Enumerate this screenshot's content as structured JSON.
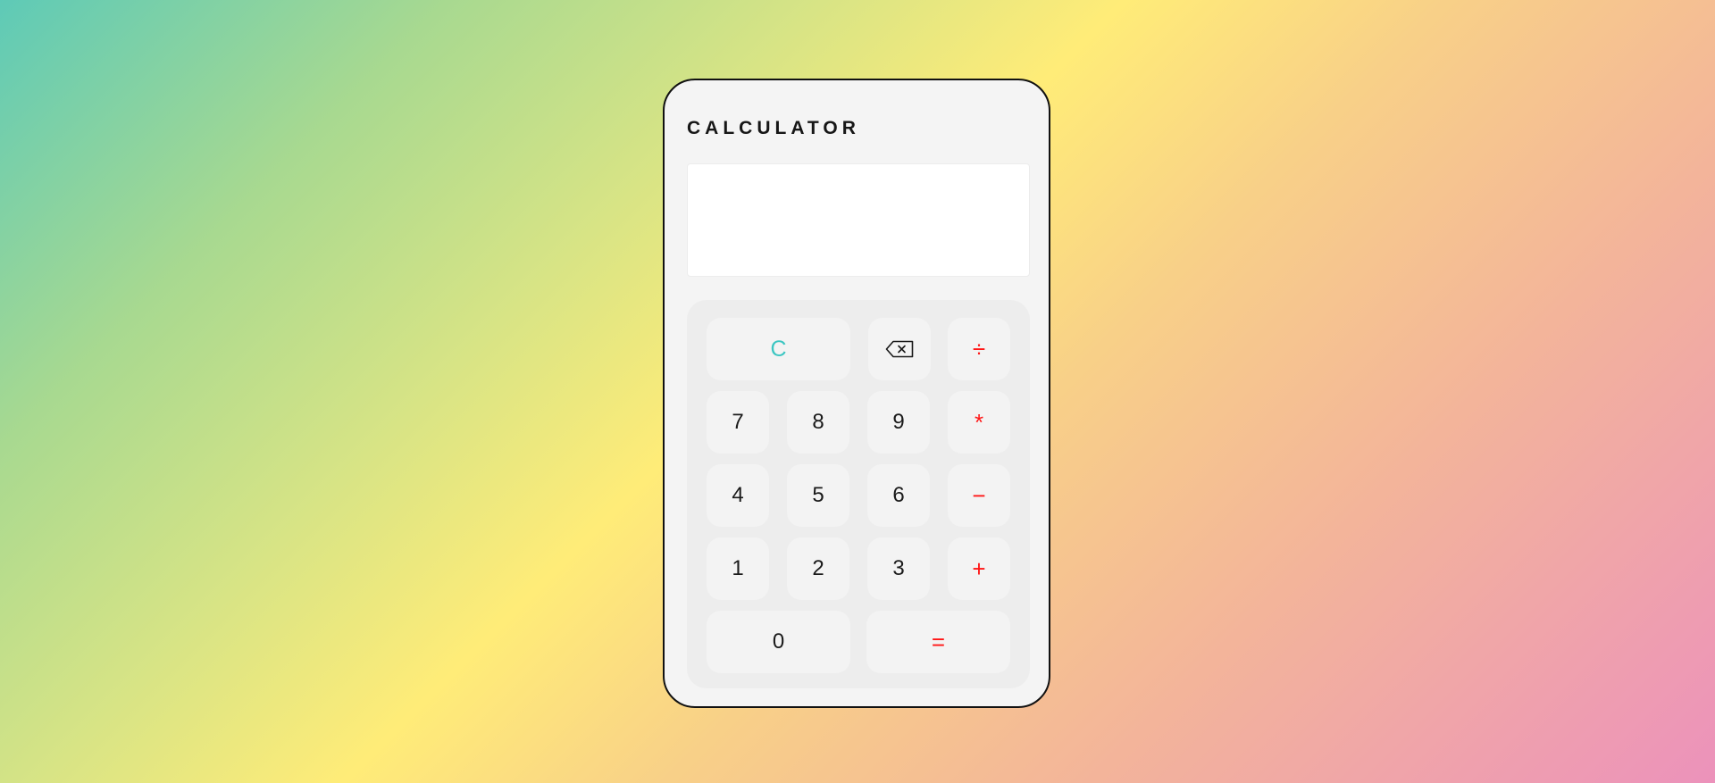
{
  "calculator": {
    "title": "CALCULATOR",
    "display": {
      "value": ""
    },
    "keys": {
      "clear": "C",
      "backspace_icon": "backspace-icon",
      "divide": "÷",
      "seven": "7",
      "eight": "8",
      "nine": "9",
      "multiply": "*",
      "four": "4",
      "five": "5",
      "six": "6",
      "subtract": "−",
      "one": "1",
      "two": "2",
      "three": "3",
      "add": "+",
      "zero": "0",
      "equals": "="
    }
  },
  "colors": {
    "operator": "#ff1515",
    "clear": "#3cc6c2",
    "card_background": "#f4f4f4",
    "keypad_background": "#ededed",
    "key_background": "#f3f3f3"
  }
}
